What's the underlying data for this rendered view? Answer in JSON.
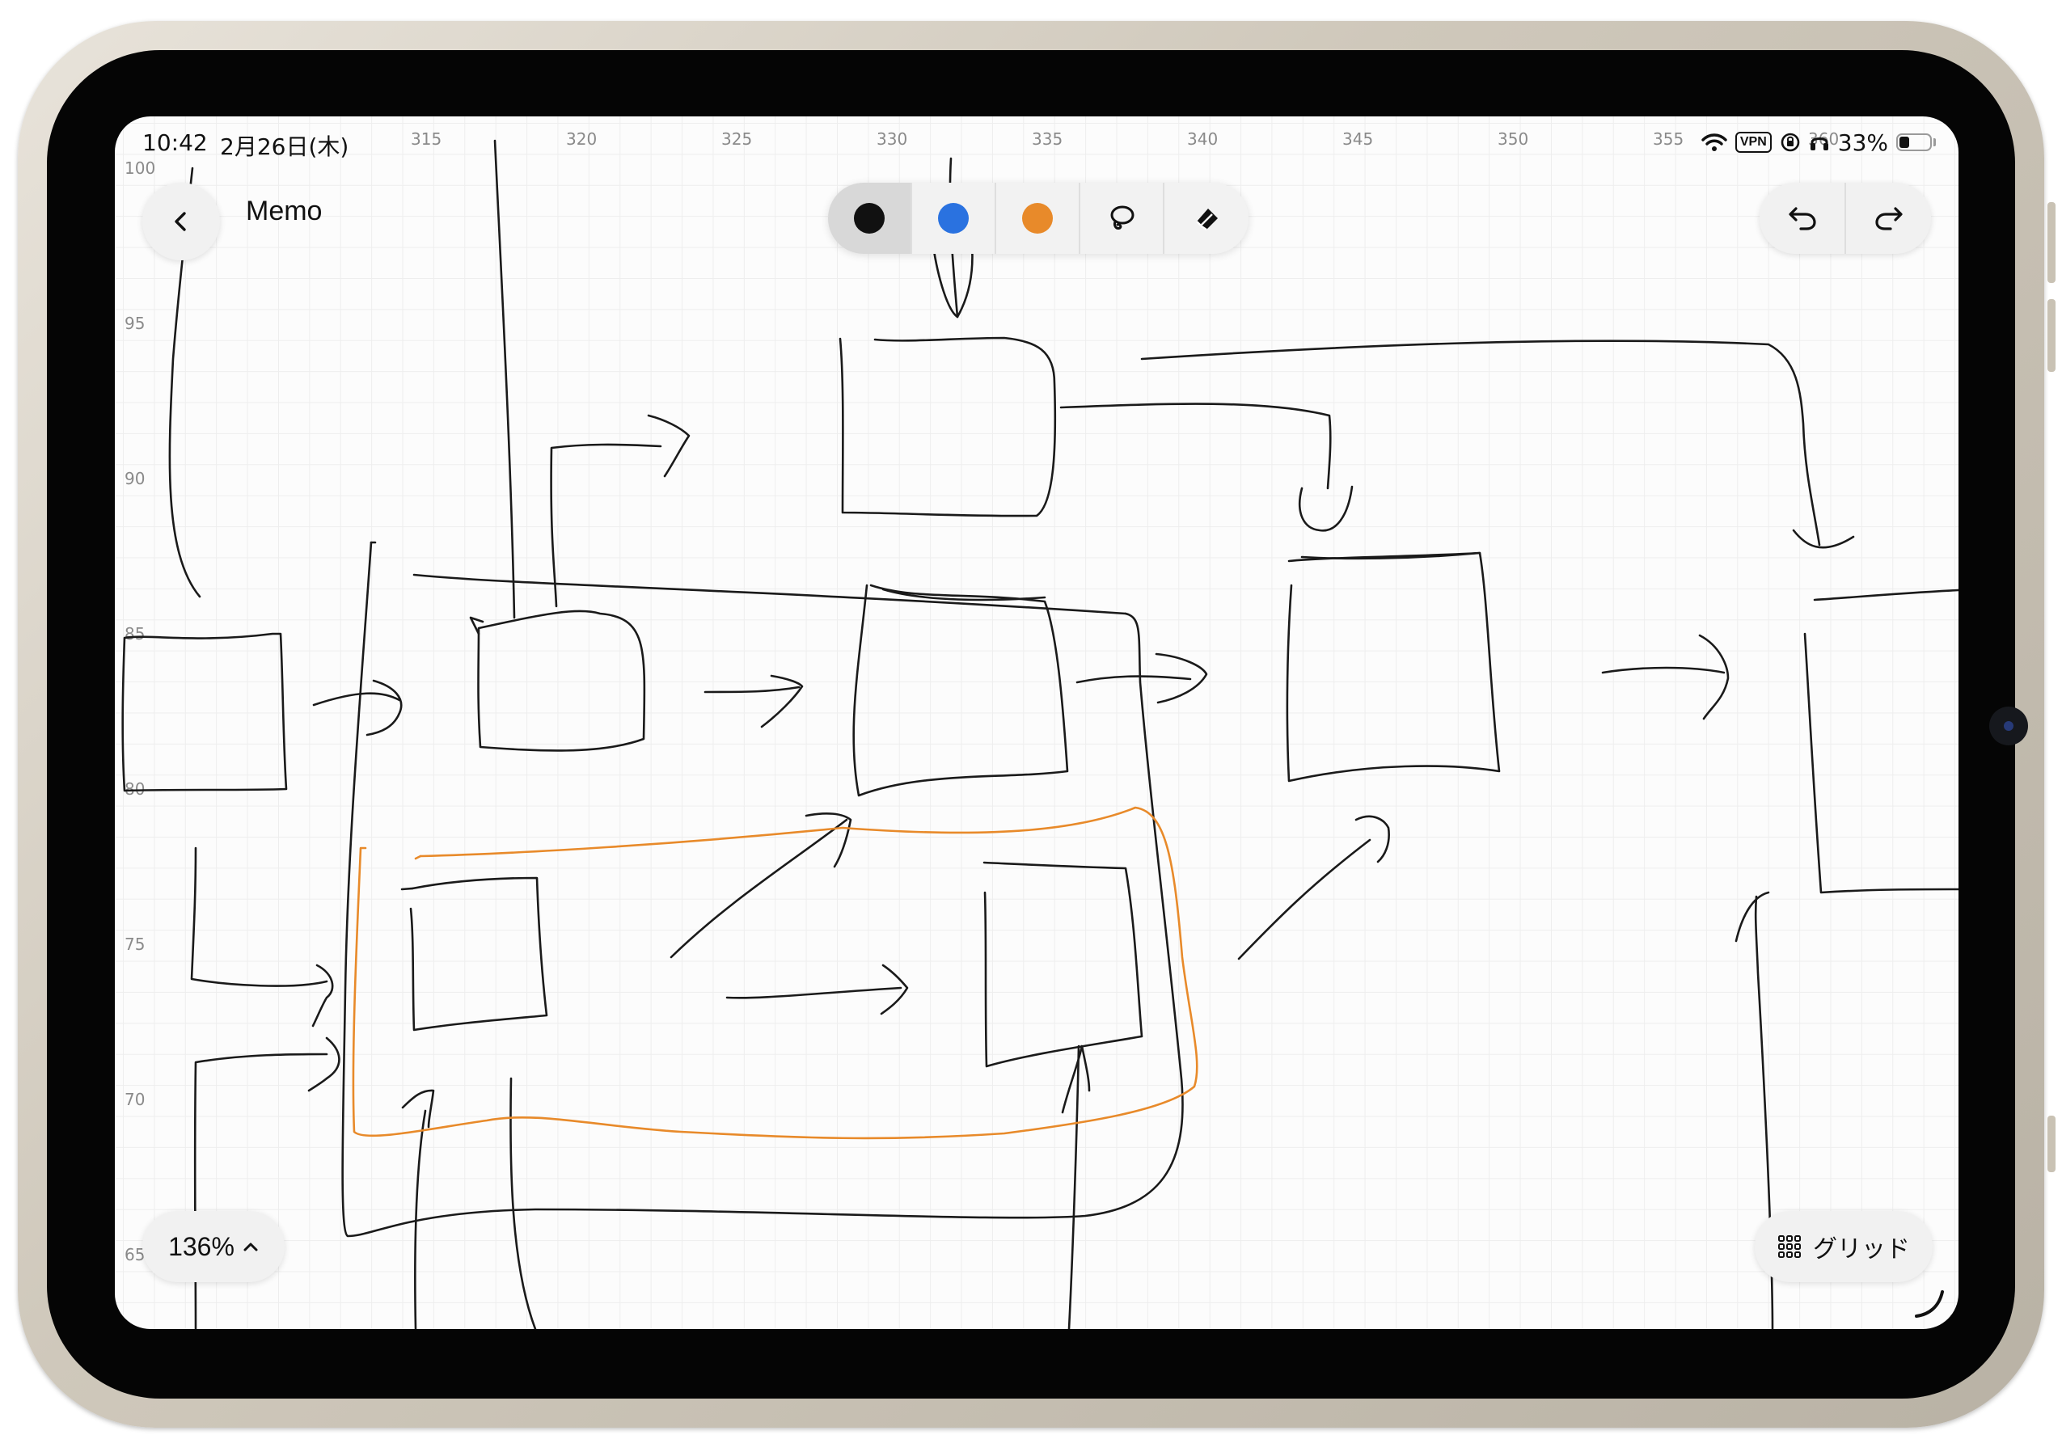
{
  "status_bar": {
    "time": "10:42",
    "date": "2月26日(木)",
    "vpn": "VPN",
    "battery_percent": "33%",
    "battery_level": 0.33
  },
  "header": {
    "title": "Memo",
    "back_icon": "chevron-left-icon"
  },
  "toolbar": {
    "colors": [
      "#111111",
      "#2a72e0",
      "#e88a2a"
    ],
    "selected_tool": "black-pen",
    "lasso_icon": "lasso-icon",
    "eraser_icon": "eraser-icon"
  },
  "history": {
    "undo_icon": "undo-icon",
    "redo_icon": "redo-icon"
  },
  "zoom": {
    "label": "136%"
  },
  "grid_toggle": {
    "label": "グリッド",
    "icon": "grid-icon"
  },
  "rulers": {
    "x_labels": [
      "315",
      "320",
      "325",
      "330",
      "335",
      "340",
      "345",
      "350",
      "355",
      "360"
    ],
    "y_labels": [
      "100",
      "95",
      "90",
      "85",
      "80",
      "75",
      "70",
      "65"
    ]
  },
  "colors": {
    "ink_black": "#1a1a1a",
    "ink_orange": "#e88a2a",
    "canvas": "#fcfcfc"
  }
}
